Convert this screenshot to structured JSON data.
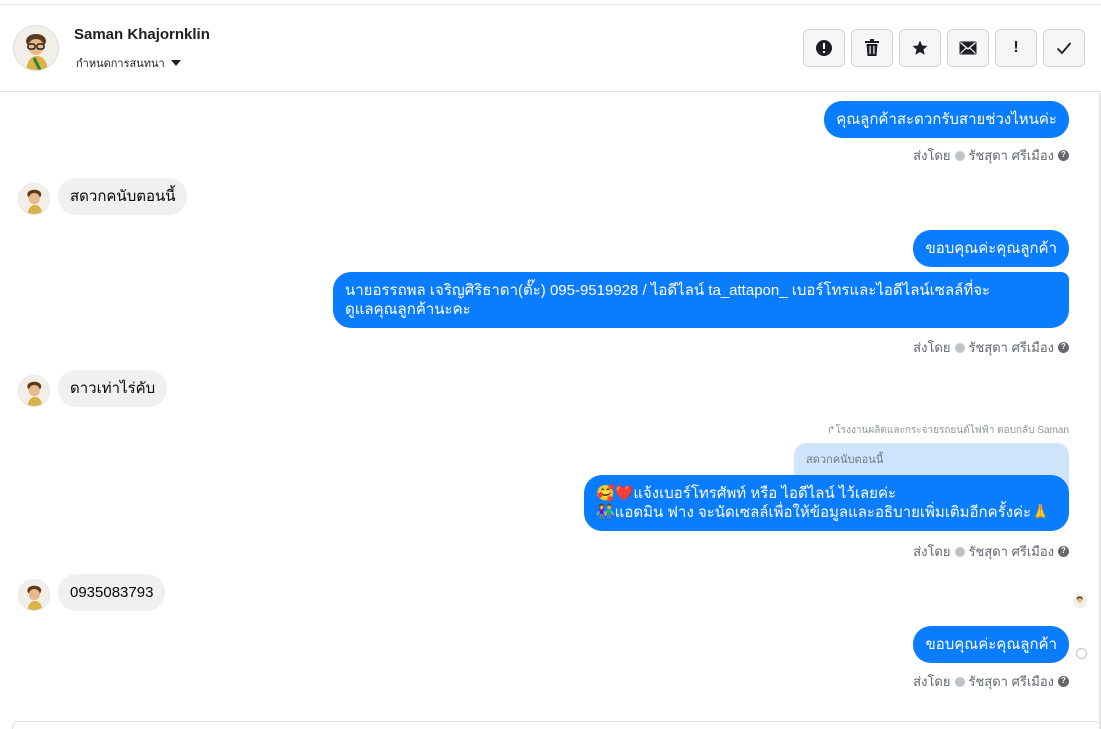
{
  "header": {
    "contact_name": "Saman Khajornklin",
    "assign_label": "กำหนดการสนทนา"
  },
  "toolbar": {
    "buttons": [
      {
        "name": "spam-button",
        "icon": "alert-circle-icon"
      },
      {
        "name": "delete-button",
        "icon": "trash-icon"
      },
      {
        "name": "star-button",
        "icon": "star-icon"
      },
      {
        "name": "mark-unread-button",
        "icon": "envelope-icon"
      },
      {
        "name": "follow-up-button",
        "icon": "exclamation-icon",
        "label": "!"
      },
      {
        "name": "done-button",
        "icon": "checkmark-icon"
      }
    ]
  },
  "sent_by_prefix": "ส่งโดย",
  "agent_name": "รัชสุดา ศรีเมือง",
  "messages": {
    "m1": {
      "text": "คุณลูกค้าสะดวกรับสายช่วงไหนค่ะ"
    },
    "m2": {
      "text": "สดวกคนับตอนนี้"
    },
    "m3": {
      "text": "ขอบคุณค่ะคุณลูกค้า"
    },
    "m4": {
      "line1": "นายอรรถพล เจริญศิริธาดา(ตั๊ะ)       095-9519928 / ไอดีไลน์ ta_attapon_  เบอร์โทรและไอดีไลน์เซลล์ที่จะ",
      "line2": "ดูแลคุณลูกค้านะคะ"
    },
    "m5": {
      "text": "ดาวเท่าไร่คับ"
    },
    "m6": {
      "reply_note": "โรงงานผลิตและกระจายรถยนต์ไฟฟ้า ตอบกลับ Saman",
      "quote": "สดวกคนับตอนนี้",
      "line1": "🥰❤️แจ้งเบอร์โทรศัพท์ หรือ ไอดีไลน์  ไว้เลยค่ะ",
      "line2": "👫แอดมิน ฟาง จะนัดเซลล์เพื่อให้ข้อมูลและอธิบายเพิ่มเติมอีกครั้งค่ะ🙏"
    },
    "m7": {
      "text": "0935083793"
    },
    "m8": {
      "text": "ขอบคุณค่ะคุณลูกค้า"
    }
  },
  "colors": {
    "outgoing_bubble": "#0a7cff",
    "incoming_bubble": "#f0f0f0",
    "quote_bubble": "#cfe3fb"
  }
}
